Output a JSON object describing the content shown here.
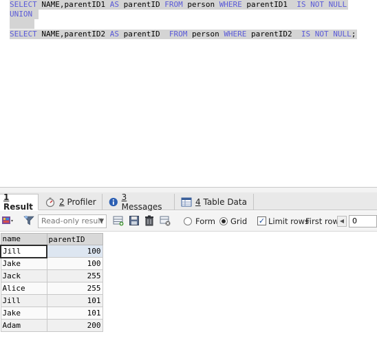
{
  "editor": {
    "line1": {
      "kw1": "SELECT",
      "t1": " NAME,parentID1 ",
      "kw2": "AS",
      "t2": " parentID ",
      "kw3": "FROM",
      "t3": " person ",
      "kw4": "WHERE",
      "t4": " parentID1  ",
      "kw5": "IS NOT NULL"
    },
    "line2": {
      "kw1": "UNION"
    },
    "line4": {
      "kw1": "SELECT",
      "t1": " NAME,parentID2 ",
      "kw2": "AS",
      "t2": " parentID  ",
      "kw3": "FROM",
      "t3": " person ",
      "kw4": "WHERE",
      "t4": " parentID2  ",
      "kw5": "IS NOT NULL",
      "t5": ";"
    }
  },
  "tabs": [
    {
      "num": "1",
      "label": "Result"
    },
    {
      "num": "2",
      "label": "Profiler"
    },
    {
      "num": "3",
      "label": "Messages"
    },
    {
      "num": "4",
      "label": "Table Data"
    }
  ],
  "toolbar": {
    "mode_select": "Read-only result",
    "form_label": "Form",
    "grid_label": "Grid",
    "limit_rows_label": "Limit rows",
    "first_row_label": "First row:",
    "first_row_value": "0"
  },
  "grid": {
    "columns": [
      "name",
      "parentID"
    ],
    "rows": [
      [
        "Jill",
        "100"
      ],
      [
        "Jake",
        "100"
      ],
      [
        "Jack",
        "255"
      ],
      [
        "Alice",
        "255"
      ],
      [
        "Jill",
        "101"
      ],
      [
        "Jake",
        "101"
      ],
      [
        "Adam",
        "200"
      ]
    ]
  },
  "colors": {
    "keyword": "#5a5ad8",
    "selection": "#d4d4d4"
  },
  "icons": [
    "results-grid-icon",
    "filter-icon",
    "add-row-icon",
    "save-icon",
    "delete-icon",
    "discard-icon",
    "profiler-icon",
    "messages-info-icon",
    "table-data-icon"
  ]
}
